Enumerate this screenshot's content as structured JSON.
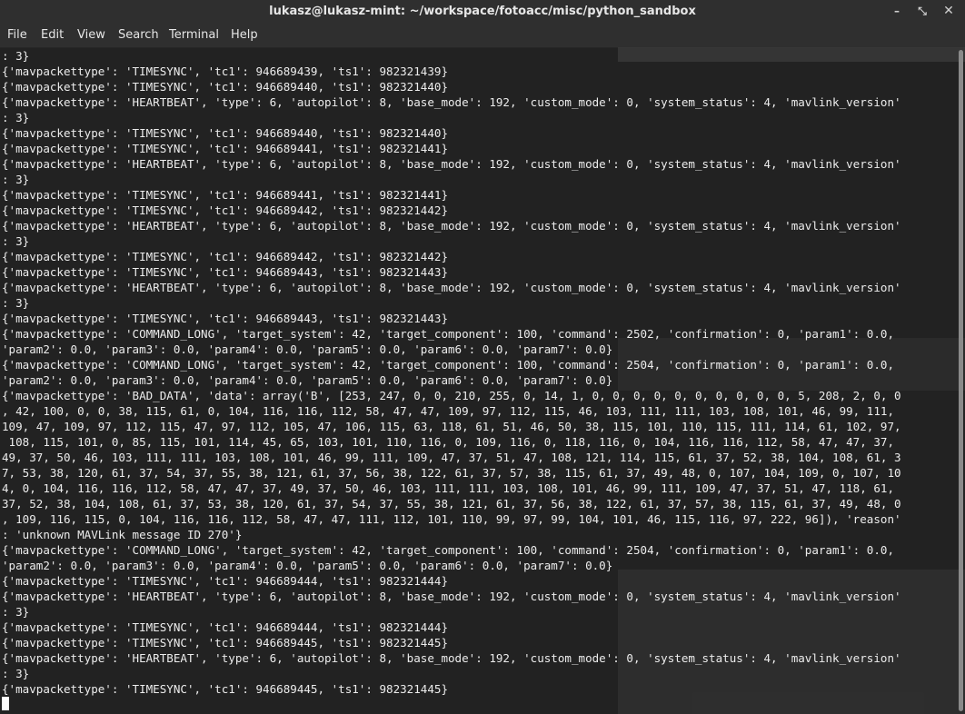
{
  "window": {
    "title": "lukasz@lukasz-mint: ~/workspace/fotoacc/misc/python_sandbox",
    "controls": {
      "minimize_glyph": "–",
      "maximize_glyph": "⤡",
      "close_glyph": "✕"
    }
  },
  "menubar": {
    "items": [
      "File",
      "Edit",
      "View",
      "Search",
      "Terminal",
      "Help"
    ]
  },
  "terminal": {
    "lines": [
      ": 3}",
      "{'mavpackettype': 'TIMESYNC', 'tc1': 946689439, 'ts1': 982321439}",
      "{'mavpackettype': 'TIMESYNC', 'tc1': 946689440, 'ts1': 982321440}",
      "{'mavpackettype': 'HEARTBEAT', 'type': 6, 'autopilot': 8, 'base_mode': 192, 'custom_mode': 0, 'system_status': 4, 'mavlink_version'",
      ": 3}",
      "{'mavpackettype': 'TIMESYNC', 'tc1': 946689440, 'ts1': 982321440}",
      "{'mavpackettype': 'TIMESYNC', 'tc1': 946689441, 'ts1': 982321441}",
      "{'mavpackettype': 'HEARTBEAT', 'type': 6, 'autopilot': 8, 'base_mode': 192, 'custom_mode': 0, 'system_status': 4, 'mavlink_version'",
      ": 3}",
      "{'mavpackettype': 'TIMESYNC', 'tc1': 946689441, 'ts1': 982321441}",
      "{'mavpackettype': 'TIMESYNC', 'tc1': 946689442, 'ts1': 982321442}",
      "{'mavpackettype': 'HEARTBEAT', 'type': 6, 'autopilot': 8, 'base_mode': 192, 'custom_mode': 0, 'system_status': 4, 'mavlink_version'",
      ": 3}",
      "{'mavpackettype': 'TIMESYNC', 'tc1': 946689442, 'ts1': 982321442}",
      "{'mavpackettype': 'TIMESYNC', 'tc1': 946689443, 'ts1': 982321443}",
      "{'mavpackettype': 'HEARTBEAT', 'type': 6, 'autopilot': 8, 'base_mode': 192, 'custom_mode': 0, 'system_status': 4, 'mavlink_version'",
      ": 3}",
      "{'mavpackettype': 'TIMESYNC', 'tc1': 946689443, 'ts1': 982321443}",
      "{'mavpackettype': 'COMMAND_LONG', 'target_system': 42, 'target_component': 100, 'command': 2502, 'confirmation': 0, 'param1': 0.0,",
      "'param2': 0.0, 'param3': 0.0, 'param4': 0.0, 'param5': 0.0, 'param6': 0.0, 'param7': 0.0}",
      "{'mavpackettype': 'COMMAND_LONG', 'target_system': 42, 'target_component': 100, 'command': 2504, 'confirmation': 0, 'param1': 0.0,",
      "'param2': 0.0, 'param3': 0.0, 'param4': 0.0, 'param5': 0.0, 'param6': 0.0, 'param7': 0.0}",
      "{'mavpackettype': 'BAD_DATA', 'data': array('B', [253, 247, 0, 0, 210, 255, 0, 14, 1, 0, 0, 0, 0, 0, 0, 0, 0, 0, 0, 5, 208, 2, 0, 0",
      ", 42, 100, 0, 0, 38, 115, 61, 0, 104, 116, 116, 112, 58, 47, 47, 109, 97, 112, 115, 46, 103, 111, 111, 103, 108, 101, 46, 99, 111,",
      "109, 47, 109, 97, 112, 115, 47, 97, 112, 105, 47, 106, 115, 63, 118, 61, 51, 46, 50, 38, 115, 101, 110, 115, 111, 114, 61, 102, 97,",
      " 108, 115, 101, 0, 85, 115, 101, 114, 45, 65, 103, 101, 110, 116, 0, 109, 116, 0, 118, 116, 0, 104, 116, 116, 112, 58, 47, 47, 37,",
      "49, 37, 50, 46, 103, 111, 111, 103, 108, 101, 46, 99, 111, 109, 47, 37, 51, 47, 108, 121, 114, 115, 61, 37, 52, 38, 104, 108, 61, 3",
      "7, 53, 38, 120, 61, 37, 54, 37, 55, 38, 121, 61, 37, 56, 38, 122, 61, 37, 57, 38, 115, 61, 37, 49, 48, 0, 107, 104, 109, 0, 107, 10",
      "4, 0, 104, 116, 116, 112, 58, 47, 47, 37, 49, 37, 50, 46, 103, 111, 111, 103, 108, 101, 46, 99, 111, 109, 47, 37, 51, 47, 118, 61,",
      "37, 52, 38, 104, 108, 61, 37, 53, 38, 120, 61, 37, 54, 37, 55, 38, 121, 61, 37, 56, 38, 122, 61, 37, 57, 38, 115, 61, 37, 49, 48, 0",
      ", 109, 116, 115, 0, 104, 116, 116, 112, 58, 47, 47, 111, 112, 101, 110, 99, 97, 99, 104, 101, 46, 115, 116, 97, 222, 96]), 'reason'",
      ": 'unknown MAVLink message ID 270'}",
      "{'mavpackettype': 'COMMAND_LONG', 'target_system': 42, 'target_component': 100, 'command': 2504, 'confirmation': 0, 'param1': 0.0,",
      "'param2': 0.0, 'param3': 0.0, 'param4': 0.0, 'param5': 0.0, 'param6': 0.0, 'param7': 0.0}",
      "{'mavpackettype': 'TIMESYNC', 'tc1': 946689444, 'ts1': 982321444}",
      "{'mavpackettype': 'HEARTBEAT', 'type': 6, 'autopilot': 8, 'base_mode': 192, 'custom_mode': 0, 'system_status': 4, 'mavlink_version'",
      ": 3}",
      "{'mavpackettype': 'TIMESYNC', 'tc1': 946689444, 'ts1': 982321444}",
      "{'mavpackettype': 'TIMESYNC', 'tc1': 946689445, 'ts1': 982321445}",
      "{'mavpackettype': 'HEARTBEAT', 'type': 6, 'autopilot': 8, 'base_mode': 192, 'custom_mode': 0, 'system_status': 4, 'mavlink_version'",
      ": 3}",
      "{'mavpackettype': 'TIMESYNC', 'tc1': 946689445, 'ts1': 982321445}"
    ]
  }
}
